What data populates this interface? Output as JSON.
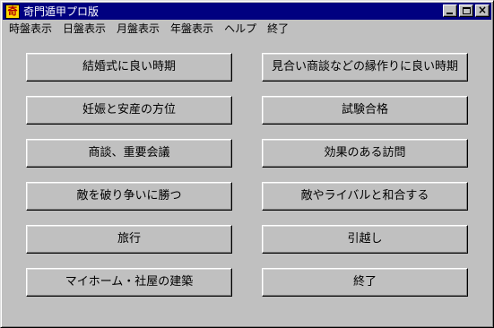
{
  "window": {
    "title": "奇門遁甲プロ版",
    "icon_char": "奇"
  },
  "menu": [
    "時盤表示",
    "日盤表示",
    "月盤表示",
    "年盤表示",
    "ヘルプ",
    "終了"
  ],
  "buttons_left": [
    "結婚式に良い時期",
    "妊娠と安産の方位",
    "商談、重要会議",
    "敵を破り争いに勝つ",
    "旅行",
    "マイホーム・社屋の建築"
  ],
  "buttons_right": [
    "見合い商談などの縁作りに良い時期",
    "試験合格",
    "効果のある訪問",
    "敵やライバルと和合する",
    "引越し",
    "終了"
  ]
}
